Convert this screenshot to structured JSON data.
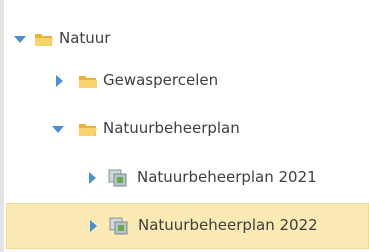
{
  "tree": {
    "nodes": [
      {
        "label": "Natuur",
        "expanded": true,
        "icon": "folder-open-icon"
      },
      {
        "label": "Gewaspercelen",
        "expanded": false,
        "icon": "folder-icon"
      },
      {
        "label": "Natuurbeheerplan",
        "expanded": true,
        "icon": "folder-open-icon"
      },
      {
        "label": "Natuurbeheerplan 2021",
        "expanded": false,
        "icon": "layer-group-icon"
      },
      {
        "label": "Natuurbeheerplan 2022",
        "expanded": false,
        "icon": "layer-group-icon",
        "selected": true
      }
    ]
  },
  "colors": {
    "toggle": "#4a8fd6",
    "folder": "#f3c34f",
    "selection_bg": "#fbeab3"
  }
}
